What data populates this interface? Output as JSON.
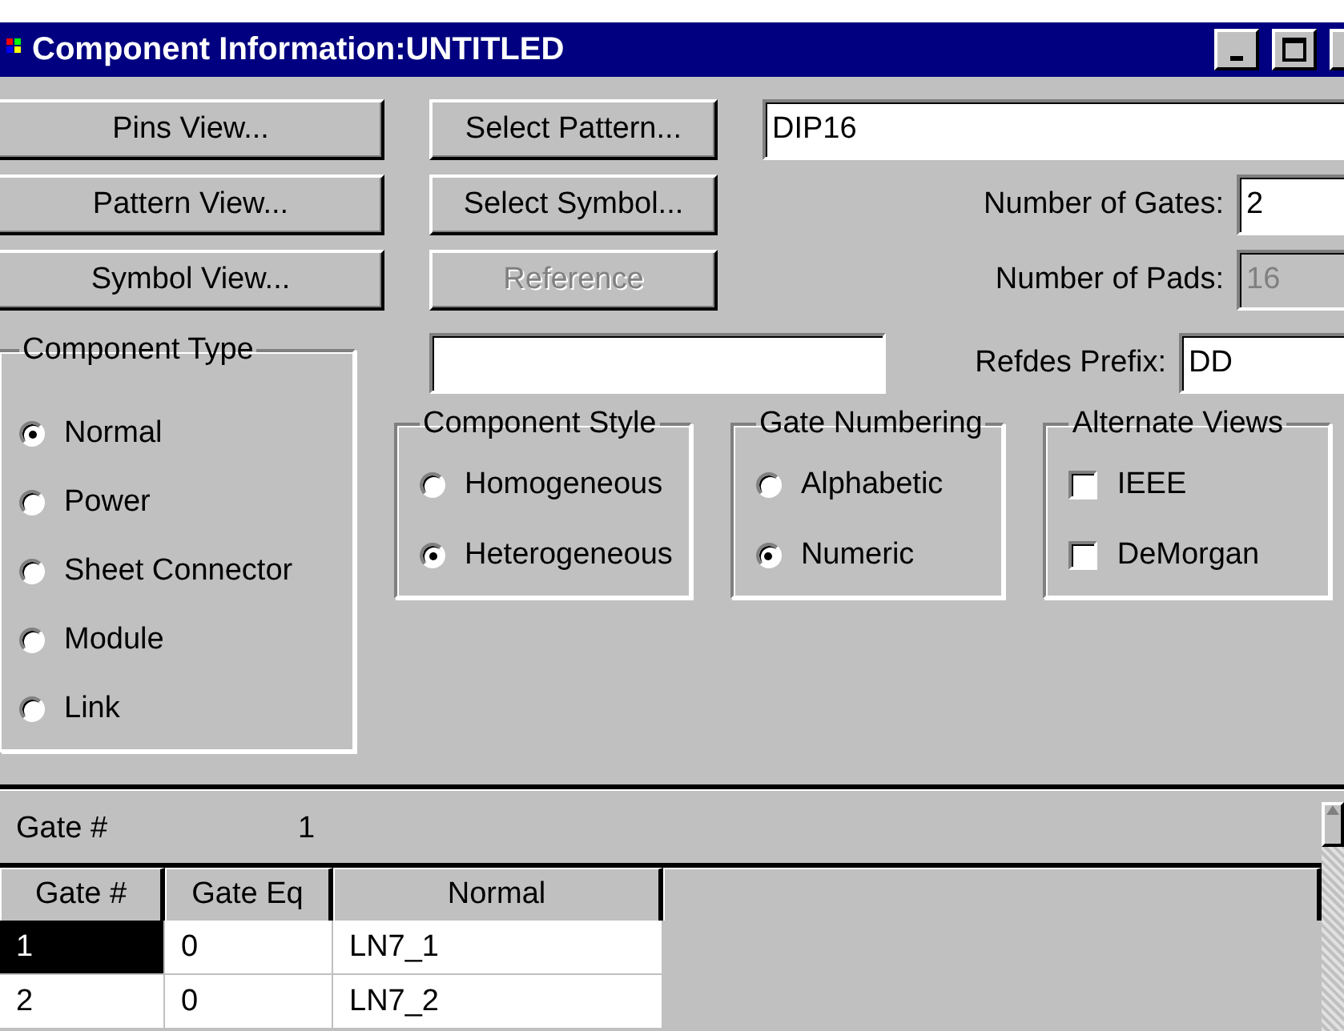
{
  "window": {
    "title": "Component Information:UNTITLED"
  },
  "view_buttons": [
    {
      "label": "Pins View...",
      "disabled": false
    },
    {
      "label": "Pattern View...",
      "disabled": false
    },
    {
      "label": "Symbol View...",
      "disabled": false
    }
  ],
  "select_buttons": [
    {
      "label": "Select Pattern...",
      "disabled": false
    },
    {
      "label": "Select Symbol...",
      "disabled": false
    },
    {
      "label": "Reference",
      "disabled": true
    }
  ],
  "pattern_field": {
    "value": "DIP16"
  },
  "number_of_gates": {
    "label": "Number of Gates:",
    "value": "2",
    "disabled": false
  },
  "number_of_pads": {
    "label": "Number of Pads:",
    "value": "16",
    "disabled": true
  },
  "refdes_prefix": {
    "label": "Refdes Prefix:",
    "value": "DD",
    "disabled": false
  },
  "component_type": {
    "title": "Component Type",
    "options": [
      {
        "label": "Normal",
        "selected": true
      },
      {
        "label": "Power",
        "selected": false
      },
      {
        "label": "Sheet Connector",
        "selected": false
      },
      {
        "label": "Module",
        "selected": false
      },
      {
        "label": "Link",
        "selected": false
      }
    ]
  },
  "component_style": {
    "title": "Component Style",
    "options": [
      {
        "label": "Homogeneous",
        "selected": false
      },
      {
        "label": "Heterogeneous",
        "selected": true
      }
    ]
  },
  "gate_numbering": {
    "title": "Gate Numbering",
    "options": [
      {
        "label": "Alphabetic",
        "selected": false
      },
      {
        "label": "Numeric",
        "selected": true
      }
    ]
  },
  "alternate_views": {
    "title": "Alternate Views",
    "options": [
      {
        "label": "IEEE",
        "checked": false
      },
      {
        "label": "DeMorgan",
        "checked": false
      }
    ]
  },
  "gate_bar": {
    "label": "Gate #",
    "value": "1"
  },
  "table": {
    "columns": [
      "Gate #",
      "Gate Eq",
      "Normal"
    ],
    "rows": [
      {
        "cells": [
          "1",
          "0",
          "LN7_1"
        ],
        "selected": true
      },
      {
        "cells": [
          "2",
          "0",
          "LN7_2"
        ],
        "selected": false
      }
    ]
  }
}
